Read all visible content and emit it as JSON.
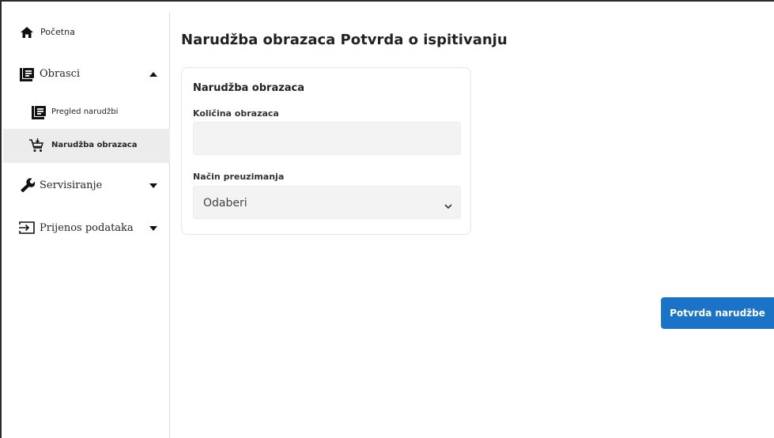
{
  "page": {
    "title": "Narudžba obrazaca Potvrda o ispitivanju"
  },
  "sidebar": {
    "items": [
      {
        "label": "Početna",
        "icon": "home-icon"
      },
      {
        "label": "Obrasci",
        "icon": "form-icon",
        "expanded": true
      },
      {
        "label": "Pregled narudžbi",
        "icon": "form-icon"
      },
      {
        "label": "Narudžba obrazaca",
        "icon": "cart-add-icon",
        "active": true
      },
      {
        "label": "Servisiranje",
        "icon": "wrench-icon",
        "expanded": false
      },
      {
        "label": "Prijenos podataka",
        "icon": "import-icon",
        "expanded": false
      }
    ]
  },
  "form": {
    "card_title": "Narudžba obrazaca",
    "quantity_label": "Količina obrazaca",
    "quantity_value": "",
    "pickup_label": "Način preuzimanja",
    "pickup_selected": "Odaberi"
  },
  "actions": {
    "submit_label": "Potvrda narudžbe"
  },
  "colors": {
    "accent": "#1a73c7",
    "active_item_bg": "#ececec"
  }
}
